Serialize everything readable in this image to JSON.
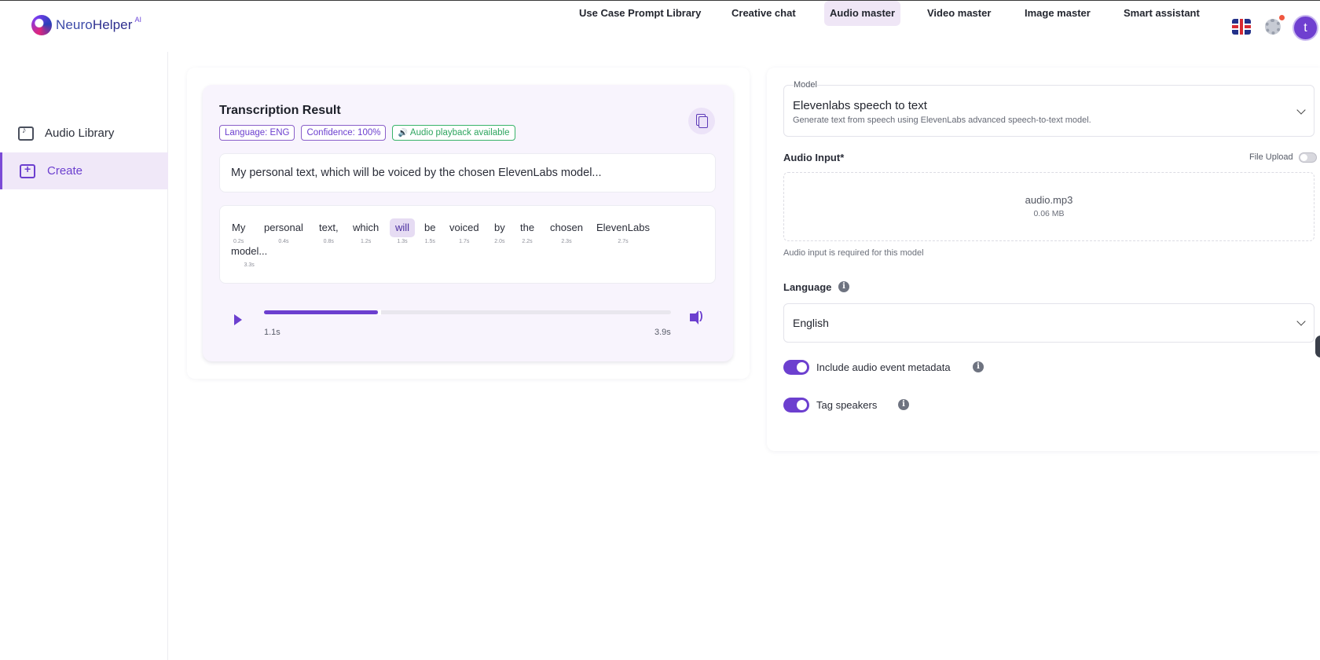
{
  "header": {
    "brand": {
      "word1": "Neuro",
      "word2": "Helper",
      "suffix": "AI"
    },
    "nav": [
      {
        "label": "Use Case Prompt Library",
        "active": false
      },
      {
        "label": "Creative chat",
        "active": false
      },
      {
        "label": "Audio master",
        "active": true
      },
      {
        "label": "Video master",
        "active": false
      },
      {
        "label": "Image master",
        "active": false
      },
      {
        "label": "Smart assistant",
        "active": false
      }
    ],
    "avatar_letter": "t"
  },
  "sidebar": {
    "items": [
      {
        "label": "Audio Library",
        "icon": "audio-library-icon",
        "active": false
      },
      {
        "label": "Create",
        "icon": "create-icon",
        "active": true
      }
    ]
  },
  "transcription": {
    "title": "Transcription Result",
    "badges": {
      "language": "Language: ENG",
      "confidence": "Confidence: 100%",
      "playback": "Audio playback available"
    },
    "text": "My personal text, which will be voiced by the chosen ElevenLabs model...",
    "words": [
      {
        "word": "My",
        "time": "0.2s"
      },
      {
        "word": "personal",
        "time": "0.4s"
      },
      {
        "word": "text,",
        "time": "0.8s"
      },
      {
        "word": "which",
        "time": "1.2s"
      },
      {
        "word": "will",
        "time": "1.3s",
        "active": true
      },
      {
        "word": "be",
        "time": "1.5s"
      },
      {
        "word": "voiced",
        "time": "1.7s"
      },
      {
        "word": "by",
        "time": "2.0s"
      },
      {
        "word": "the",
        "time": "2.2s"
      },
      {
        "word": "chosen",
        "time": "2.3s"
      },
      {
        "word": "ElevenLabs",
        "time": "2.7s"
      },
      {
        "word": "model...",
        "time": "3.3s"
      }
    ],
    "player": {
      "current": "1.1s",
      "total": "3.9s",
      "progress": 0.28
    }
  },
  "settings": {
    "model": {
      "legend": "Model",
      "name": "Elevenlabs speech to text",
      "description": "Generate text from speech using ElevenLabs advanced speech-to-text model."
    },
    "audio_input": {
      "label": "Audio Input*",
      "file_upload_label": "File Upload",
      "file_name": "audio.mp3",
      "file_size": "0.06 MB",
      "helper": "Audio input is required for this model"
    },
    "language": {
      "label": "Language",
      "value": "English"
    },
    "toggles": [
      {
        "label": "Include audio event metadata",
        "on": true
      },
      {
        "label": "Tag speakers",
        "on": true
      }
    ]
  },
  "colors": {
    "accent": "#6c3fcf",
    "active_bg": "#efe6f6",
    "success": "#2ea55f"
  }
}
